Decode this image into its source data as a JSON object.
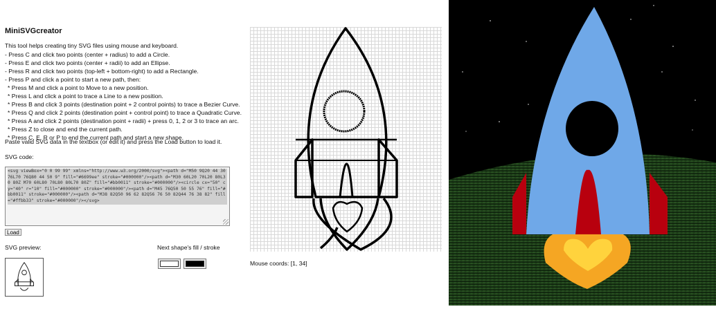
{
  "app": {
    "title": "MiniSVGcreator",
    "intro": "This tool helps creating tiny SVG files using mouse and keyboard."
  },
  "help_lines": [
    {
      "text": "- Press C and click two points (center + radius) to add a Circle.",
      "sub": false
    },
    {
      "text": "- Press E and click two points (center + radii) to add an Ellipse.",
      "sub": false
    },
    {
      "text": "- Press R and click two points (top-left + bottom-right) to add a Rectangle.",
      "sub": false
    },
    {
      "text": "- Press P and click a point to start a new path, then:",
      "sub": false
    },
    {
      "text": "* Press M and click a point to Move to a new position.",
      "sub": true
    },
    {
      "text": "* Press L and click a point to trace a Line to a new position.",
      "sub": true
    },
    {
      "text": "* Press B and click 3 points (destination point + 2 control points) to trace a Bezier Curve.",
      "sub": true
    },
    {
      "text": "* Press Q and click 2 points (destination point + control point) to trace a Quadratic Curve.",
      "sub": true
    },
    {
      "text": "* Press A and click 2 points (destination point + radii) + press 0, 1, 2 or 3 to trace an arc.",
      "sub": true
    },
    {
      "text": "* Press Z to close and end the current path.",
      "sub": true
    },
    {
      "text": "* Press C, E, R or P to end the current path and start a new shape.",
      "sub": true
    }
  ],
  "paste_note": "Paste valid SVG data in the textbox (or edit it) and press the Load button to load it.",
  "code": {
    "label": "SVG code:",
    "value": "<svg viewBox=\"0 0 99 99\" xmlns=\"http://www.w3.org/2000/svg\"><path d=\"M50 9Q20 44 30 76L70 76Q80 44 50 9\" fill=\"#6699ee\" stroke=\"#000000\"/><path d=\"M30 60L20 70L20 80L30 80Z M70 60L80 70L80 80L70 80Z\" fill=\"#bb0011\" stroke=\"#000000\"/><circle cx=\"50\" cy=\"40\" r=\"10\" fill=\"#000000\" stroke=\"#000000\"/><path d=\"M45 76Q50 50 55 76\" fill=\"#bb0011\" stroke=\"#000000\"/><path d=\"M38 82Q50 96 62 82Q56 76 50 82Q44 76 38 82\" fill=\"#ffbb33\" stroke=\"#000000\"/></svg>"
  },
  "load_label": "Load",
  "preview_label": "SVG preview:",
  "fill_stroke_label": "Next shape's fill / stroke",
  "fill_color": "#ffffff",
  "stroke_color": "#000000",
  "mouse_label": "Mouse coords: [1, 34]",
  "colors": {
    "body": "#6fa8e8",
    "fins": "#b8000e",
    "flame_outer": "#f5a623",
    "flame_inner": "#ffd33d",
    "window": "#000000"
  }
}
